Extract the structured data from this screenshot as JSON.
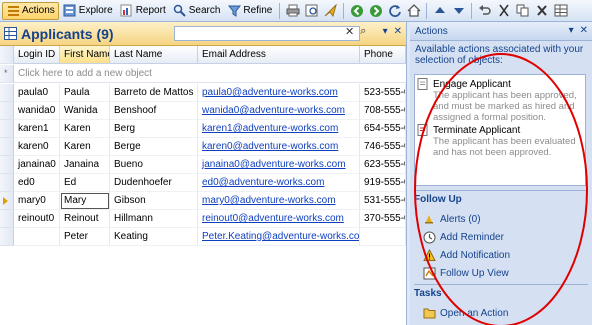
{
  "toolbar": {
    "actions_label": "Actions",
    "explore_label": "Explore",
    "report_label": "Report",
    "search_label": "Search",
    "refine_label": "Refine"
  },
  "left_panel": {
    "title": "Applicants (9)",
    "search_placeholder": "",
    "columns": [
      "Login ID",
      "First Name",
      "Last Name",
      "Email Address",
      "Phone"
    ],
    "sorted_column": "First Name",
    "new_row_text": "Click here to add a new object",
    "rows": [
      {
        "login": "paula0",
        "first": "Paula",
        "last": "Barreto de Mattos",
        "email": "paula0@adventure-works.com",
        "phone": "523-555-01"
      },
      {
        "login": "wanida0",
        "first": "Wanida",
        "last": "Benshoof",
        "email": "wanida0@adventure-works.com",
        "phone": "708-555-01"
      },
      {
        "login": "karen1",
        "first": "Karen",
        "last": "Berg",
        "email": "karen1@adventure-works.com",
        "phone": "654-555-01"
      },
      {
        "login": "karen0",
        "first": "Karen",
        "last": "Berge",
        "email": "karen0@adventure-works.com",
        "phone": "746-555-01"
      },
      {
        "login": "janaina0",
        "first": "Janaina",
        "last": "Bueno",
        "email": "janaina0@adventure-works.com",
        "phone": "623-555-01"
      },
      {
        "login": "ed0",
        "first": "Ed",
        "last": "Dudenhoefer",
        "email": "ed0@adventure-works.com",
        "phone": "919-555-01"
      },
      {
        "login": "mary0",
        "first": "Mary",
        "last": "Gibson",
        "email": "mary0@adventure-works.com",
        "phone": "531-555-01"
      },
      {
        "login": "reinout0",
        "first": "Reinout",
        "last": "Hillmann",
        "email": "reinout0@adventure-works.com",
        "phone": "370-555-01"
      },
      {
        "login": "",
        "first": "Peter",
        "last": "Keating",
        "email": "Peter.Keating@adventure-works.com",
        "phone": ""
      }
    ],
    "current_row_index": 6
  },
  "right_panel": {
    "title": "Actions",
    "available_text": "Available actions associated with your selection of objects:",
    "actions": [
      {
        "title": "Engage Applicant",
        "description": "The applicant has been approved, and must be marked as hired and assigned a formal position."
      },
      {
        "title": "Terminate Applicant",
        "description": "The applicant has been evaluated and has not been approved."
      }
    ],
    "follow_up_heading": "Follow Up",
    "follow_up_items": [
      "Alerts (0)",
      "Add Reminder",
      "Add Notification",
      "Follow Up View"
    ],
    "tasks_heading": "Tasks",
    "tasks_items": [
      "Open an Action"
    ]
  },
  "colors": {
    "accent": "#15428b",
    "header_gold": "#f6d481",
    "link": "#1040c0",
    "annotation_red": "#e00000"
  },
  "icons": [
    "actions-icon",
    "explore-icon",
    "report-icon",
    "search-icon",
    "refine-icon",
    "print-icon",
    "preview-icon",
    "send-icon",
    "back-icon",
    "forward-icon",
    "refresh-icon",
    "home-icon",
    "up-icon",
    "down-icon",
    "undo-icon",
    "cut-icon",
    "copy-icon",
    "delete-icon",
    "grid-icon",
    "clear-icon",
    "go-icon",
    "alert-icon",
    "reminder-icon",
    "notification-icon",
    "view-icon",
    "folder-icon"
  ]
}
